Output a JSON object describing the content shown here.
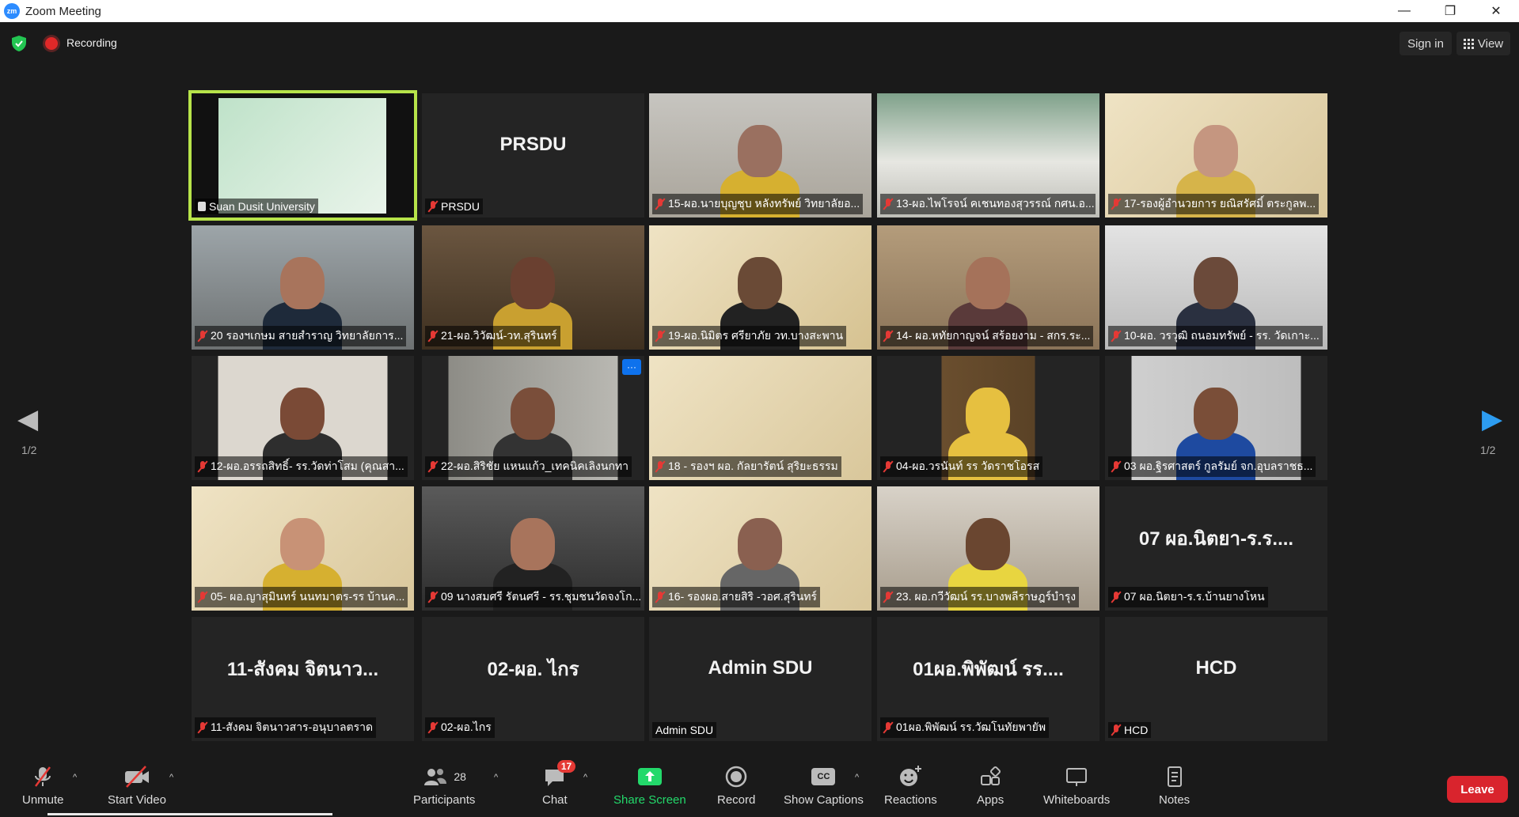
{
  "window": {
    "title": "Zoom Meeting",
    "minimize": "—",
    "restore": "❐",
    "close": "✕"
  },
  "topbar": {
    "recording": "Recording",
    "sign_in": "Sign in",
    "view": "View"
  },
  "pagination": {
    "left": "1/2",
    "right": "1/2"
  },
  "tiles": [
    {
      "name": "Suan Dusit University",
      "big": "",
      "muted": false,
      "share": true
    },
    {
      "name": "PRSDU",
      "big": "PRSDU",
      "muted": true
    },
    {
      "name": "15-ผอ.นายบุญชุบ หลังทรัพย์ วิทยาลัยอ...",
      "big": "",
      "muted": true
    },
    {
      "name": "13-ผอ.ไพโรจน์ คเชนทองสุวรรณ์ กศน.อ...",
      "big": "",
      "muted": true
    },
    {
      "name": "17-รองผู้อำนวยการ ยณิสรัศมิ์ ตระกูลพ...",
      "big": "",
      "muted": true
    },
    {
      "name": "20 รองฯเกษม สายสำราญ  วิทยาลัยการ...",
      "big": "",
      "muted": true
    },
    {
      "name": "21-ผอ.วิวัฒน์-วท.สุรินทร์",
      "big": "",
      "muted": true
    },
    {
      "name": "19-ผอ.นิมิตร ศรียาภัย  วท.บางสะพาน",
      "big": "",
      "muted": true
    },
    {
      "name": "14- ผอ.หทัยกาญจน์ สร้อยงาม - สกร.ระ...",
      "big": "",
      "muted": true
    },
    {
      "name": "10-ผอ. วรวุฒิ ถนอมทรัพย์ - รร. วัดเกาะ...",
      "big": "",
      "muted": true
    },
    {
      "name": "12-ผอ.อรรถสิทธิ์- รร.วัดท่าโสม (คุณสา...",
      "big": "",
      "muted": true
    },
    {
      "name": "22-ผอ.สิริชัย แหนแก้ว_เทคนิคเลิงนกทา",
      "big": "",
      "muted": true,
      "more": "···"
    },
    {
      "name": "18 - รองฯ ผอ. กัลยารัตน์  สุริยะธรรม",
      "big": "",
      "muted": true
    },
    {
      "name": "04-ผอ.วรนันท์ รร วัดราชโอรส",
      "big": "",
      "muted": true
    },
    {
      "name": "03 ผอ.ฐิรศาสตร์ กูลรัมย์  จก.อุบลราชธ...",
      "big": "",
      "muted": true
    },
    {
      "name": "05- ผอ.ญาสุมินทร์ นนทมาตร-รร บ้านค...",
      "big": "",
      "muted": true
    },
    {
      "name": "09 นางสมศรี รัตนศรี - รร.ชุมชนวัดจงโก...",
      "big": "",
      "muted": true
    },
    {
      "name": "16- รองผอ.สายสิริ -วอศ.สุรินทร์",
      "big": "",
      "muted": true
    },
    {
      "name": "23. ผอ.กวีวัฒน์  รร.บางพลีราษฎร์บำรุง",
      "big": "",
      "muted": true
    },
    {
      "name": "07 ผอ.นิตยา-ร.ร.บ้านยางโหน",
      "big": "07 ผอ.นิตยา-ร.ร....",
      "muted": true
    },
    {
      "name": "11-สังคม จิตนาวสาร-อนุบาลตราด",
      "big": "11-สังคม จิตนาว...",
      "muted": true
    },
    {
      "name": "02-ผอ.ไกร",
      "big": "02-ผอ. ไกร",
      "muted": true
    },
    {
      "name": "Admin SDU",
      "big": "Admin SDU",
      "muted": false
    },
    {
      "name": "01ผอ.พิพัฒน์ รร.วัฒโนทัยพายัพ",
      "big": "01ผอ.พิพัฒน์ รร....",
      "muted": true
    },
    {
      "name": "HCD",
      "big": "HCD",
      "muted": true
    }
  ],
  "toolbar": {
    "unmute": "Unmute",
    "start_video": "Start Video",
    "participants": "Participants",
    "participants_count": "28",
    "chat": "Chat",
    "chat_badge": "17",
    "share_screen": "Share Screen",
    "record": "Record",
    "show_captions": "Show Captions",
    "cc": "CC",
    "reactions": "Reactions",
    "apps": "Apps",
    "whiteboards": "Whiteboards",
    "notes": "Notes",
    "leave": "Leave"
  },
  "colors": {
    "accent_green": "#23d96b",
    "active_border": "#b7e44a",
    "leave_red": "#d9242d",
    "muted_red": "#e53935"
  }
}
